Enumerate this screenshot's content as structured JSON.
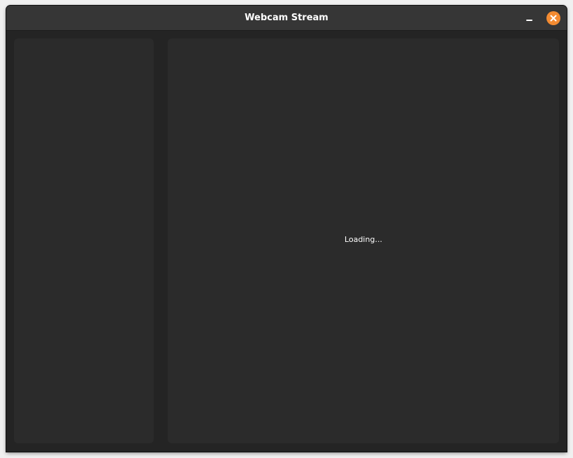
{
  "window": {
    "title": "Webcam Stream"
  },
  "controls": {
    "minimize_icon": "minimize-icon",
    "close_icon": "close-icon",
    "close_color": "#f38b32"
  },
  "main": {
    "status_text": "Loading..."
  },
  "colors": {
    "window_bg": "#242424",
    "titlebar_bg": "#363636",
    "panel_bg": "#2b2b2b",
    "text": "#ffffff"
  }
}
